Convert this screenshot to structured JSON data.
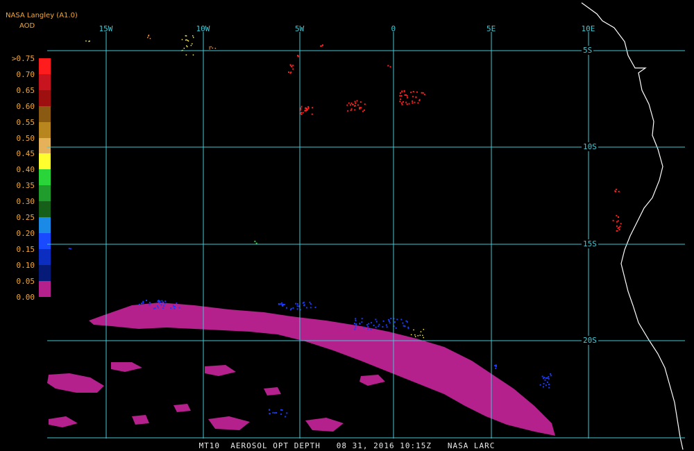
{
  "header": {
    "product": "NASA Langley (A1.0)",
    "parameter": "AOD"
  },
  "color_scale": {
    "labels": [
      ">0.75",
      "0.70",
      "0.65",
      "0.60",
      "0.55",
      "0.50",
      "0.45",
      "0.40",
      "0.35",
      "0.30",
      "0.25",
      "0.20",
      "0.15",
      "0.10",
      "0.05",
      "0.00"
    ],
    "colors": [
      "#ff1c1c",
      "#c8141e",
      "#9e1010",
      "#8a5a12",
      "#b8861e",
      "#e5b25a",
      "#ffff30",
      "#2ad53a",
      "#1f9c2c",
      "#155f18",
      "#1b8ae6",
      "#1a4aff",
      "#0c2ec0",
      "#061a78",
      "#b4208c",
      "#b4208c"
    ]
  },
  "grid": {
    "lon_labels": [
      "15W",
      "10W",
      "5W",
      "0",
      "5E",
      "10E"
    ],
    "lat_labels": [
      "5S",
      "10S",
      "15S",
      "20S"
    ],
    "line_color": "#42c9d4"
  },
  "colors": {
    "plume": "#b4208c",
    "high_aod": "#ff2020",
    "low_aod": "#1a3cff",
    "coastline": "#ffffff",
    "text_accent": "#f2a93b"
  },
  "footer": {
    "text": "MT10  AEROSOL OPT DEPTH   08 31, 2016 10:15Z   NASA LARC"
  }
}
